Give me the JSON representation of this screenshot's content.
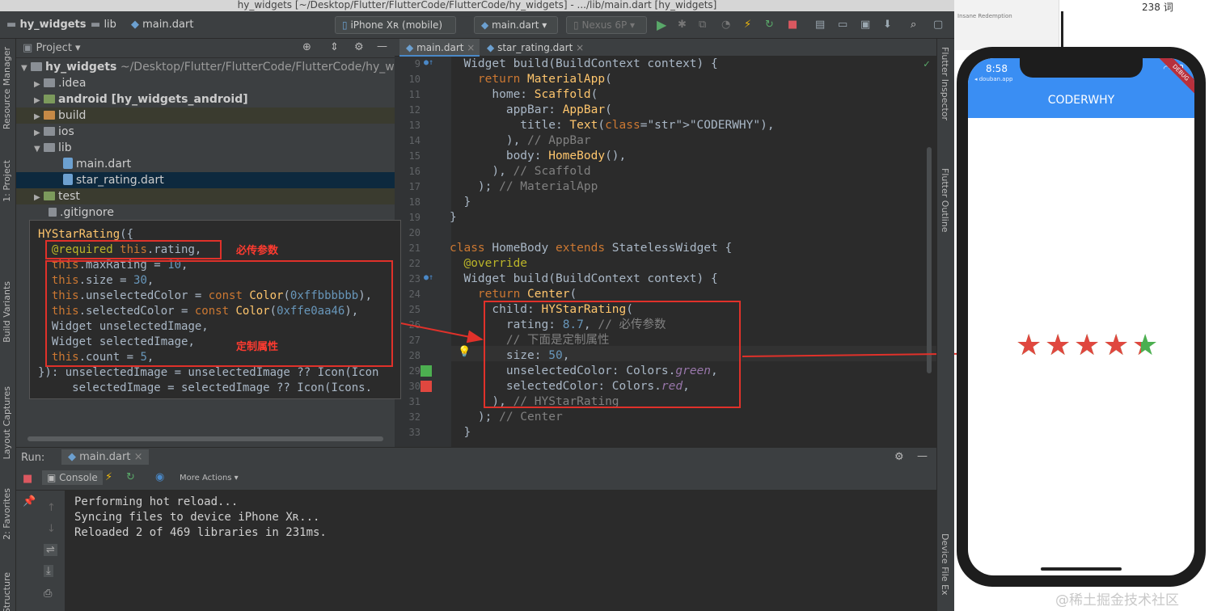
{
  "window_title": "hy_widgets [~/Desktop/Flutter/FlutterCode/FlutterCode/hy_widgets] - .../lib/main.dart [hy_widgets]",
  "toolbar": {
    "breadcrumb": [
      "hy_widgets",
      "lib",
      "main.dart"
    ],
    "device": "iPhone Xʀ (mobile)",
    "run_config": "main.dart",
    "emulator": "Nexus 6P"
  },
  "left_strip": [
    "Resource Manager",
    "1: Project",
    "Build Variants",
    "Layout Captures",
    "2: Favorites",
    "Structure"
  ],
  "right_strip": [
    "Flutter Inspector",
    "Flutter Outline",
    "Device File Ex"
  ],
  "project": {
    "header": "Project",
    "tree": [
      {
        "label": "hy_widgets",
        "extra": "~/Desktop/Flutter/FlutterCode/FlutterCode/hy_widget"
      },
      {
        "label": ".idea"
      },
      {
        "label": "android [hy_widgets_android]"
      },
      {
        "label": "build"
      },
      {
        "label": "ios"
      },
      {
        "label": "lib"
      },
      {
        "label": "main.dart"
      },
      {
        "label": "star_rating.dart"
      },
      {
        "label": "test"
      },
      {
        "label": ".gitignore"
      }
    ]
  },
  "snippet": {
    "lines": [
      "HYStarRating({",
      "  @required this.rating,",
      "  this.maxRating = 10,",
      "  this.size = 30,",
      "  this.unselectedColor = const Color(0xffbbbbbb),",
      "  this.selectedColor = const Color(0xffe0aa46),",
      "  Widget unselectedImage,",
      "  Widget selectedImage,",
      "  this.count = 5,",
      "}): unselectedImage = unselectedImage ?? Icon(Icon",
      "     selectedImage = selectedImage ?? Icon(Icons."
    ],
    "label_required": "必传参数",
    "label_custom": "定制属性"
  },
  "editor": {
    "tabs": [
      "main.dart",
      "star_rating.dart"
    ],
    "line_numbers": [
      "9",
      "10",
      "11",
      "12",
      "13",
      "14",
      "15",
      "16",
      "17",
      "18",
      "19",
      "20",
      "21",
      "22",
      "23",
      "24",
      "25",
      "26",
      "27",
      "28",
      "29",
      "30",
      "31",
      "32",
      "33"
    ],
    "lines": [
      "  Widget build(BuildContext context) {",
      "    return MaterialApp(",
      "      home: Scaffold(",
      "        appBar: AppBar(",
      "          title: Text(\"CODERWHY\"),",
      "        ), // AppBar",
      "        body: HomeBody(),",
      "      ), // Scaffold",
      "    ); // MaterialApp",
      "  }",
      "}",
      "",
      "class HomeBody extends StatelessWidget {",
      "  @override",
      "  Widget build(BuildContext context) {",
      "    return Center(",
      "      child: HYStarRating(",
      "        rating: 8.7, // 必传参数",
      "        // 下面是定制属性",
      "        size: 50,",
      "        unselectedColor: Colors.green,",
      "        selectedColor: Colors.red,",
      "      ), // HYStarRating",
      "    ); // Center",
      "  }"
    ]
  },
  "run": {
    "label": "Run:",
    "tab": "main.dart",
    "console_tab": "Console",
    "more_actions": "More Actions",
    "output": [
      "Performing hot reload...",
      "Syncing files to device iPhone Xʀ...",
      "Reloaded 2 of 469 libraries in 231ms."
    ]
  },
  "desktop": {
    "word_count": "238 词",
    "strip_text": "Insane Redemption"
  },
  "phone": {
    "time": "8:58",
    "source": "◂ douban.app",
    "debug_banner": "DEBUG",
    "app_title": "CODERWHY",
    "rating": 8.7,
    "star_count": 5,
    "selected_color": "#e0473f",
    "unselected_color": "#4caf50"
  },
  "watermark": "@稀土掘金技术社区"
}
